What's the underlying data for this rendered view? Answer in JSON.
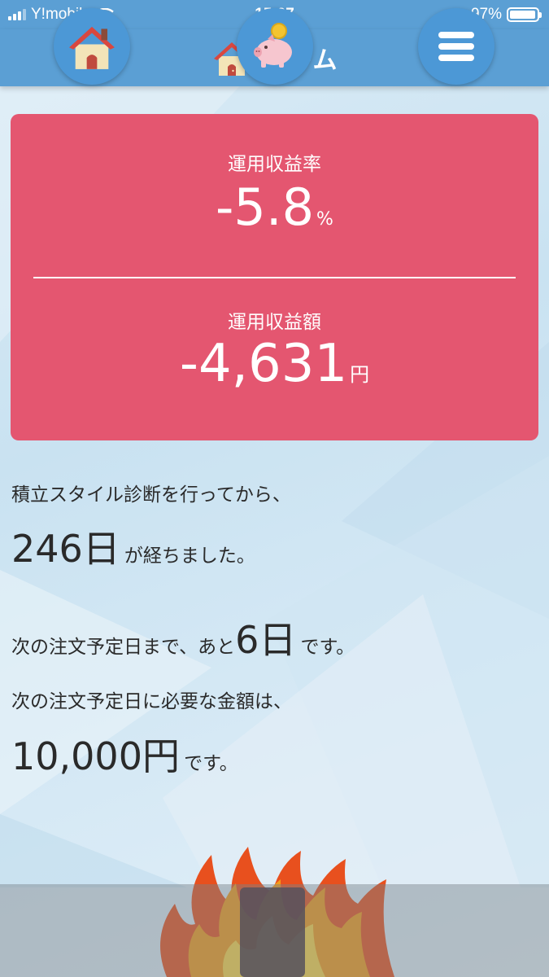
{
  "status_bar": {
    "carrier": "Y!mobile",
    "time": "15:07",
    "battery_percent": "97%",
    "battery_level": 0.97
  },
  "nav": {
    "title": "ホーム",
    "icon": "house-icon"
  },
  "return_card": {
    "rate_label": "運用収益率",
    "rate_value": "-5.8",
    "rate_unit": "%",
    "amount_label": "運用収益額",
    "amount_value": "-4,631",
    "amount_unit": "円",
    "color": "#e45670"
  },
  "info": {
    "since_text": "積立スタイル診断を行ってから、",
    "days_elapsed": "246日",
    "days_suffix": "が経ちました。",
    "next_order_prefix": "次の注文予定日まで、あと",
    "days_remaining": "6日",
    "next_order_suffix": "です。",
    "required_amount_text": "次の注文予定日に必要な金額は、",
    "required_amount": "10,000円",
    "required_amount_suffix": "です。"
  },
  "tab_bar": {
    "items": [
      {
        "name": "home",
        "icon": "house-icon"
      },
      {
        "name": "savings",
        "icon": "piggy-bank-icon"
      },
      {
        "name": "menu",
        "icon": "menu-icon"
      }
    ],
    "accent": "#4c98d6"
  },
  "colors": {
    "header": "#5b9fd4",
    "card": "#e45670",
    "text": "#2a2a2a"
  }
}
